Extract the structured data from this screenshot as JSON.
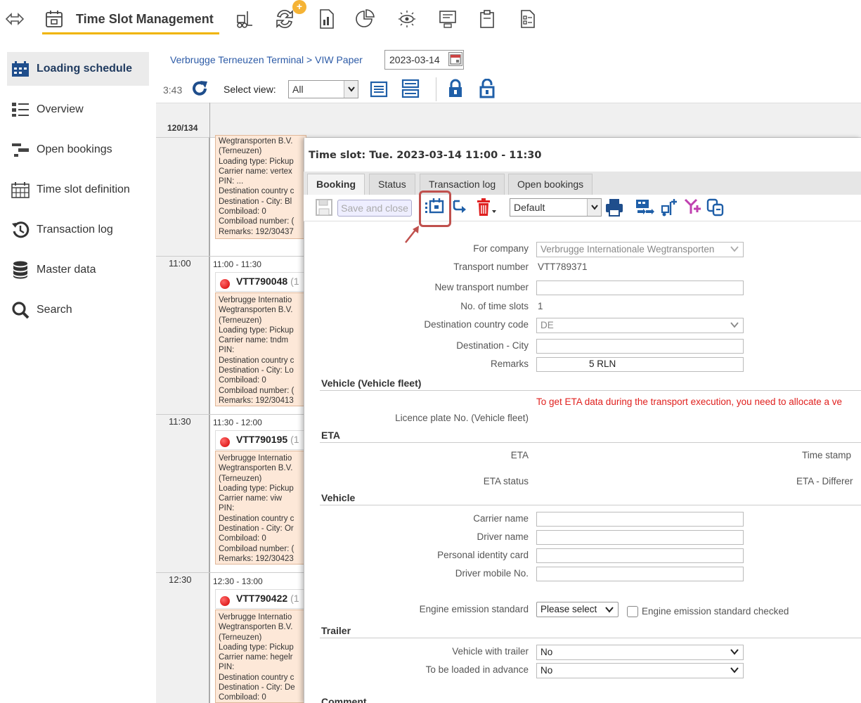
{
  "app": {
    "title": "Time Slot Management",
    "badge": "+"
  },
  "sidebar": {
    "items": [
      {
        "label": "Loading schedule",
        "icon": "schedule-icon"
      },
      {
        "label": "Overview",
        "icon": "list-icon"
      },
      {
        "label": "Open bookings",
        "icon": "open-bookings-icon"
      },
      {
        "label": "Time slot definition",
        "icon": "calendar-grid-icon"
      },
      {
        "label": "Transaction log",
        "icon": "history-icon"
      },
      {
        "label": "Master data",
        "icon": "database-icon"
      },
      {
        "label": "Search",
        "icon": "search-icon"
      }
    ]
  },
  "header": {
    "breadcrumb": "Verbrugge Terneuzen Terminal > VIW Paper",
    "date": "2023-03-14",
    "timer": "3:43",
    "select_view_label": "Select view:",
    "select_view_value": "All"
  },
  "schedule": {
    "count": "120/134",
    "first_card_lines": [
      "Wegtransporten B.V.",
      "(Terneuzen)",
      "Loading type: Pickup",
      "Carrier name: vertex",
      "PIN: ...",
      "Destination country c",
      "Destination - City: Bl",
      "Combiload: 0",
      "Combiload number: (",
      "Remarks: 192/30437"
    ],
    "slots": [
      {
        "time": "11:00",
        "range": "11:00 - 11:30",
        "id": "VTT790048",
        "count": "(1",
        "lines": [
          "Verbrugge Internatio",
          "Wegtransporten B.V.",
          "(Terneuzen)",
          "Loading type: Pickup",
          "Carrier name: tndm",
          "PIN:",
          "Destination country c",
          "Destination - City: Lo",
          "Combiload: 0",
          "Combiload number: (",
          "Remarks: 192/30413"
        ]
      },
      {
        "time": "11:30",
        "range": "11:30 - 12:00",
        "id": "VTT790195",
        "count": "(1",
        "lines": [
          "Verbrugge Internatio",
          "Wegtransporten B.V.",
          "(Terneuzen)",
          "Loading type: Pickup",
          "Carrier name: viw",
          "PIN:",
          "Destination country c",
          "Destination - City: Or",
          "Combiload: 0",
          "Combiload number: (",
          "Remarks: 192/30423"
        ]
      },
      {
        "time": "12:30",
        "range": "12:30 - 13:00",
        "id": "VTT790422",
        "count": "(1",
        "lines": [
          "Verbrugge Internatio",
          "Wegtransporten B.V.",
          "(Terneuzen)",
          "Loading type: Pickup",
          "Carrier name: hegelr",
          "PIN:",
          "Destination country c",
          "Destination - City: De",
          "Combiload: 0"
        ]
      }
    ]
  },
  "dialog": {
    "title": "Time slot: Tue. 2023-03-14 11:00 - 11:30",
    "tabs": [
      "Booking",
      "Status",
      "Transaction log",
      "Open bookings"
    ],
    "save_close": "Save and close",
    "layout_select": "Default",
    "fields": {
      "for_company": {
        "label": "For company",
        "value": "Verbrugge Internationale Wegtransporten"
      },
      "transport_number": {
        "label": "Transport number",
        "value": "VTT789371"
      },
      "new_transport_number": {
        "label": "New transport number",
        "value": ""
      },
      "num_slots": {
        "label": "No. of time slots",
        "value": "1"
      },
      "dest_country": {
        "label": "Destination country code",
        "value": "DE"
      },
      "dest_city": {
        "label": "Destination - City",
        "value": ""
      },
      "remarks": {
        "label": "Remarks",
        "value": "5 RLN"
      }
    },
    "vehicle_fleet": {
      "title": "Vehicle (Vehicle fleet)",
      "note": "To get ETA data during the transport execution, you need to allocate a ve",
      "licence_label": "Licence plate No. (Vehicle fleet)"
    },
    "eta": {
      "title": "ETA",
      "eta_label": "ETA",
      "status_label": "ETA status",
      "timestamp_label": "Time stamp",
      "difference_label": "ETA - Differer"
    },
    "vehicle": {
      "title": "Vehicle",
      "carrier_label": "Carrier name",
      "driver_label": "Driver name",
      "id_card_label": "Personal identity card",
      "mobile_label": "Driver mobile No.",
      "emission_label": "Engine emission standard",
      "emission_value": "Please select",
      "emission_checked_label": "Engine emission standard checked"
    },
    "trailer": {
      "title": "Trailer",
      "with_trailer_label": "Vehicle with trailer",
      "with_trailer_value": "No",
      "advance_label": "To be loaded in advance",
      "advance_value": "No"
    },
    "comment_title": "Comment"
  },
  "colors": {
    "accent": "#f0b400",
    "link": "#2d5ba7",
    "highlight": "#c0504d",
    "warning": "#e0201e",
    "card": "#fde8d8",
    "toolbar_blue": "#1f5fa8",
    "delete_red": "#e02020"
  }
}
